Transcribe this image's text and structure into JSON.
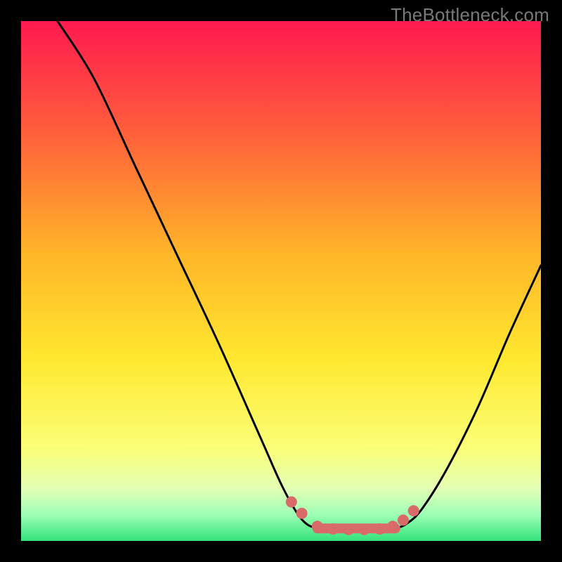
{
  "watermark": "TheBottleneck.com",
  "colors": {
    "background": "#000000",
    "curve": "#000000",
    "marker": "#d96a6a",
    "gradient_stops": [
      {
        "pct": 0,
        "color": "#ff1a4f"
      },
      {
        "pct": 20,
        "color": "#ff5a3c"
      },
      {
        "pct": 45,
        "color": "#ffb628"
      },
      {
        "pct": 65,
        "color": "#ffe82f"
      },
      {
        "pct": 82,
        "color": "#fbff77"
      },
      {
        "pct": 90,
        "color": "#e3ffb5"
      },
      {
        "pct": 95,
        "color": "#9cffb5"
      },
      {
        "pct": 100,
        "color": "#33e27a"
      }
    ]
  },
  "chart_data": {
    "type": "line",
    "title": "",
    "xlabel": "",
    "ylabel": "",
    "xlim": [
      0,
      100
    ],
    "ylim": [
      0,
      100
    ],
    "left_curve": [
      {
        "x": 7,
        "y": 100
      },
      {
        "x": 14,
        "y": 89
      },
      {
        "x": 22,
        "y": 72
      },
      {
        "x": 30,
        "y": 55
      },
      {
        "x": 38,
        "y": 38
      },
      {
        "x": 46,
        "y": 20
      },
      {
        "x": 50,
        "y": 11
      },
      {
        "x": 53,
        "y": 5.5
      },
      {
        "x": 55,
        "y": 3.2
      },
      {
        "x": 57,
        "y": 2.4
      }
    ],
    "right_curve": [
      {
        "x": 72,
        "y": 2.4
      },
      {
        "x": 74,
        "y": 3.2
      },
      {
        "x": 77,
        "y": 6
      },
      {
        "x": 82,
        "y": 14
      },
      {
        "x": 88,
        "y": 26
      },
      {
        "x": 94,
        "y": 40
      },
      {
        "x": 100,
        "y": 53
      }
    ],
    "flat_segment": [
      {
        "x": 57,
        "y": 2.4
      },
      {
        "x": 72,
        "y": 2.4
      }
    ],
    "markers": [
      {
        "x": 52,
        "y": 7.5
      },
      {
        "x": 54,
        "y": 5.3
      },
      {
        "x": 57,
        "y": 2.8
      },
      {
        "x": 60,
        "y": 2.3
      },
      {
        "x": 63,
        "y": 2.2
      },
      {
        "x": 66,
        "y": 2.2
      },
      {
        "x": 69,
        "y": 2.3
      },
      {
        "x": 71.5,
        "y": 2.8
      },
      {
        "x": 73.5,
        "y": 4.0
      },
      {
        "x": 75.5,
        "y": 5.8
      }
    ]
  }
}
